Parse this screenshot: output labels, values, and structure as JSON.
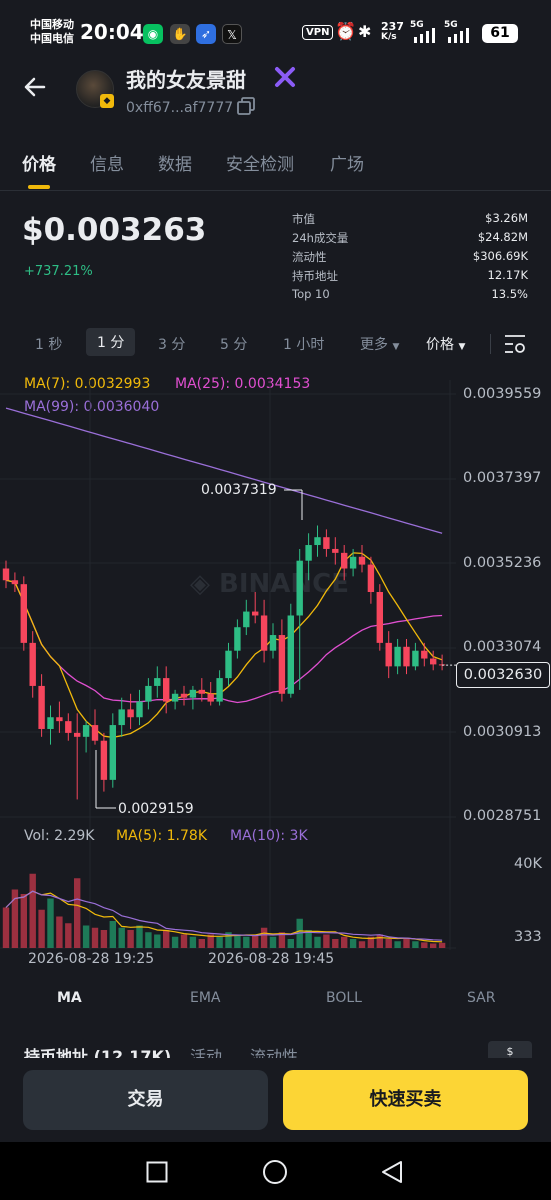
{
  "status_bar": {
    "carrier1": "中国移动",
    "carrier2": "中国电信",
    "time": "20:04",
    "vpn": "VPN",
    "speed_value": "237",
    "speed_unit": "K/s",
    "net1": "5G",
    "net2": "5G",
    "battery": "61"
  },
  "header": {
    "token_name": "我的女友景甜",
    "address": "0xff67...af7777"
  },
  "tabs": [
    {
      "label": "价格"
    },
    {
      "label": "信息"
    },
    {
      "label": "数据"
    },
    {
      "label": "安全检测"
    },
    {
      "label": "广场"
    }
  ],
  "price": {
    "value": "$0.003263",
    "change": "+737.21%"
  },
  "stats": [
    {
      "label": "市值",
      "value": "$3.26M"
    },
    {
      "label": "24h成交量",
      "value": "$24.82M"
    },
    {
      "label": "流动性",
      "value": "$306.69K"
    },
    {
      "label": "持币地址",
      "value": "12.17K"
    },
    {
      "label": "Top 10",
      "value": "13.5%"
    }
  ],
  "intervals": {
    "i1": "1 秒",
    "i2": "1 分",
    "i3": "3 分",
    "i4": "5 分",
    "i5": "1 小时",
    "more": "更多",
    "price_mode": "价格"
  },
  "ma_legend": {
    "ma7": "MA(7): 0.0032993",
    "ma25": "MA(25): 0.0034153",
    "ma99": "MA(99): 0.0036040"
  },
  "price_axis": [
    "0.0039559",
    "0.0037397",
    "0.0035236",
    "0.0033074",
    "0.0030913",
    "0.0028751"
  ],
  "last_price": "0.0032630",
  "high_label": "0.0037319",
  "low_label": "0.0029159",
  "watermark": "BINANCE",
  "vol_legend": {
    "vol": "Vol: 2.29K",
    "ma5": "MA(5): 1.78K",
    "ma10": "MA(10): 3K"
  },
  "vol_axis": [
    "40K",
    "333"
  ],
  "time_labels": [
    "2026-08-28 19:25",
    "2026-08-28 19:45"
  ],
  "indicator_tabs": [
    {
      "label": "MA"
    },
    {
      "label": "EMA"
    },
    {
      "label": "BOLL"
    },
    {
      "label": "SAR"
    }
  ],
  "section_tabs": {
    "holders": "持币地址 (12.17K)",
    "activity": "活动",
    "liquidity": "流动性",
    "currency": "$"
  },
  "buttons": {
    "trade": "交易",
    "quick": "快速买卖"
  },
  "colors": {
    "up": "#2ebd85",
    "down": "#f6465d",
    "ma7": "#f0b90b",
    "ma25": "#e04fd0",
    "ma99": "#9a6fd8",
    "accent": "#fcd535"
  },
  "chart_data": {
    "type": "candlestick",
    "interval": "1 分",
    "ylim": [
      0.0028751,
      0.0039559
    ],
    "candles": [
      {
        "o": 0.00351,
        "h": 0.00353,
        "l": 0.00346,
        "c": 0.00348
      },
      {
        "o": 0.00348,
        "h": 0.0035,
        "l": 0.00345,
        "c": 0.00347
      },
      {
        "o": 0.00347,
        "h": 0.00349,
        "l": 0.0033,
        "c": 0.00332
      },
      {
        "o": 0.00332,
        "h": 0.00335,
        "l": 0.00318,
        "c": 0.00321
      },
      {
        "o": 0.00321,
        "h": 0.00324,
        "l": 0.00308,
        "c": 0.0031
      },
      {
        "o": 0.0031,
        "h": 0.00316,
        "l": 0.00306,
        "c": 0.00313
      },
      {
        "o": 0.00313,
        "h": 0.00317,
        "l": 0.00309,
        "c": 0.00312
      },
      {
        "o": 0.00312,
        "h": 0.00314,
        "l": 0.00307,
        "c": 0.00309
      },
      {
        "o": 0.00309,
        "h": 0.00314,
        "l": 0.00292,
        "c": 0.00308
      },
      {
        "o": 0.00308,
        "h": 0.00312,
        "l": 0.00304,
        "c": 0.00311
      },
      {
        "o": 0.00311,
        "h": 0.00315,
        "l": 0.00306,
        "c": 0.00307
      },
      {
        "o": 0.00307,
        "h": 0.00309,
        "l": 0.00294,
        "c": 0.00297
      },
      {
        "o": 0.00297,
        "h": 0.00314,
        "l": 0.00295,
        "c": 0.00311
      },
      {
        "o": 0.00311,
        "h": 0.00318,
        "l": 0.00308,
        "c": 0.00315
      },
      {
        "o": 0.00315,
        "h": 0.00319,
        "l": 0.0031,
        "c": 0.00313
      },
      {
        "o": 0.00313,
        "h": 0.0032,
        "l": 0.00311,
        "c": 0.00317
      },
      {
        "o": 0.00317,
        "h": 0.00323,
        "l": 0.00315,
        "c": 0.00321
      },
      {
        "o": 0.00321,
        "h": 0.00326,
        "l": 0.00318,
        "c": 0.00323
      },
      {
        "o": 0.00323,
        "h": 0.00326,
        "l": 0.00314,
        "c": 0.00317
      },
      {
        "o": 0.00317,
        "h": 0.0032,
        "l": 0.00315,
        "c": 0.00319
      },
      {
        "o": 0.00319,
        "h": 0.00321,
        "l": 0.00316,
        "c": 0.00318
      },
      {
        "o": 0.00318,
        "h": 0.00321,
        "l": 0.00315,
        "c": 0.0032
      },
      {
        "o": 0.0032,
        "h": 0.00323,
        "l": 0.00317,
        "c": 0.00319
      },
      {
        "o": 0.00319,
        "h": 0.00322,
        "l": 0.00316,
        "c": 0.00317
      },
      {
        "o": 0.00317,
        "h": 0.00325,
        "l": 0.00316,
        "c": 0.00323
      },
      {
        "o": 0.00323,
        "h": 0.00332,
        "l": 0.00321,
        "c": 0.0033
      },
      {
        "o": 0.0033,
        "h": 0.00338,
        "l": 0.00328,
        "c": 0.00336
      },
      {
        "o": 0.00336,
        "h": 0.00343,
        "l": 0.00334,
        "c": 0.0034
      },
      {
        "o": 0.0034,
        "h": 0.00345,
        "l": 0.00337,
        "c": 0.00339
      },
      {
        "o": 0.00339,
        "h": 0.00343,
        "l": 0.00327,
        "c": 0.0033
      },
      {
        "o": 0.0033,
        "h": 0.00337,
        "l": 0.00328,
        "c": 0.00334
      },
      {
        "o": 0.00334,
        "h": 0.00338,
        "l": 0.00317,
        "c": 0.00319
      },
      {
        "o": 0.00319,
        "h": 0.00342,
        "l": 0.00318,
        "c": 0.00339
      },
      {
        "o": 0.00339,
        "h": 0.00356,
        "l": 0.0032,
        "c": 0.00353
      },
      {
        "o": 0.00353,
        "h": 0.0036,
        "l": 0.00348,
        "c": 0.00357
      },
      {
        "o": 0.00357,
        "h": 0.00362,
        "l": 0.00354,
        "c": 0.00359
      },
      {
        "o": 0.00359,
        "h": 0.00361,
        "l": 0.00354,
        "c": 0.00356
      },
      {
        "o": 0.00356,
        "h": 0.00359,
        "l": 0.00352,
        "c": 0.00355
      },
      {
        "o": 0.00355,
        "h": 0.00357,
        "l": 0.00348,
        "c": 0.00351
      },
      {
        "o": 0.00351,
        "h": 0.00356,
        "l": 0.00349,
        "c": 0.00354
      },
      {
        "o": 0.00354,
        "h": 0.00357,
        "l": 0.0035,
        "c": 0.00352
      },
      {
        "o": 0.00352,
        "h": 0.00354,
        "l": 0.00342,
        "c": 0.00345
      },
      {
        "o": 0.00345,
        "h": 0.00347,
        "l": 0.0033,
        "c": 0.00332
      },
      {
        "o": 0.00332,
        "h": 0.00335,
        "l": 0.00323,
        "c": 0.00326
      },
      {
        "o": 0.00326,
        "h": 0.00333,
        "l": 0.00324,
        "c": 0.00331
      },
      {
        "o": 0.00331,
        "h": 0.00333,
        "l": 0.00324,
        "c": 0.00326
      },
      {
        "o": 0.00326,
        "h": 0.00332,
        "l": 0.00325,
        "c": 0.0033
      },
      {
        "o": 0.0033,
        "h": 0.00332,
        "l": 0.00326,
        "c": 0.00328
      },
      {
        "o": 0.00328,
        "h": 0.0033,
        "l": 0.00325,
        "c": 0.003265
      },
      {
        "o": 0.003265,
        "h": 0.00329,
        "l": 0.00325,
        "c": 0.003263
      }
    ],
    "volumes": [
      18,
      26,
      24,
      33,
      17,
      22,
      14,
      11,
      31,
      10,
      9,
      8,
      12,
      9,
      8,
      10,
      7,
      6,
      8,
      5,
      6,
      5,
      4,
      6,
      5,
      7,
      6,
      5,
      6,
      9,
      5,
      7,
      4,
      13,
      8,
      5,
      6,
      4,
      5,
      4,
      3,
      5,
      6,
      4,
      3,
      4,
      3,
      2.5,
      2,
      2.29
    ],
    "vol_ylim": [
      0,
      40
    ]
  }
}
